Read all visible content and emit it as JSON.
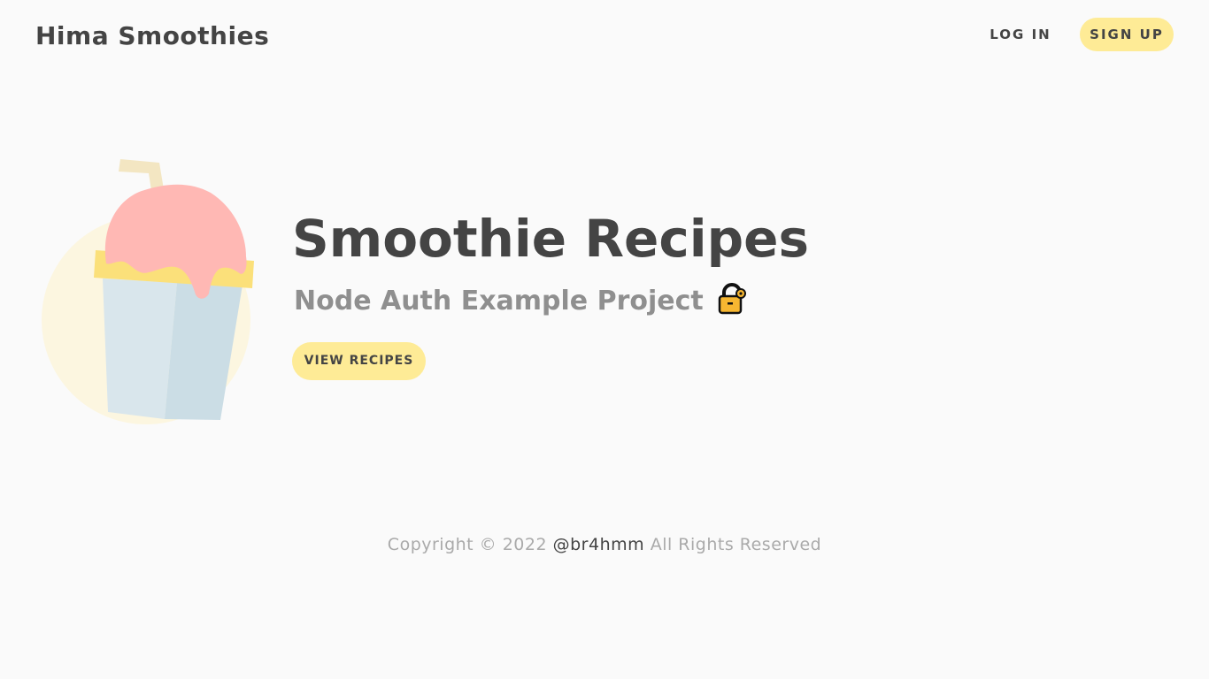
{
  "nav": {
    "brand": "Hima Smoothies",
    "login_label": "LOG IN",
    "signup_label": "SIGN UP"
  },
  "hero": {
    "title": "Smoothie Recipes",
    "subtitle": "Node Auth Example Project",
    "subtitle_icon": "lock-icon",
    "cta_label": "VIEW RECIPES",
    "illustration": "smoothie-cup-icon"
  },
  "footer": {
    "prefix": "Copyright © 2022",
    "handle": "@br4hmm",
    "suffix": "All Rights Reserved"
  },
  "colors": {
    "background": "#fafafa",
    "accent": "#feeb96",
    "text": "#444444",
    "muted": "#8f8f8f"
  }
}
